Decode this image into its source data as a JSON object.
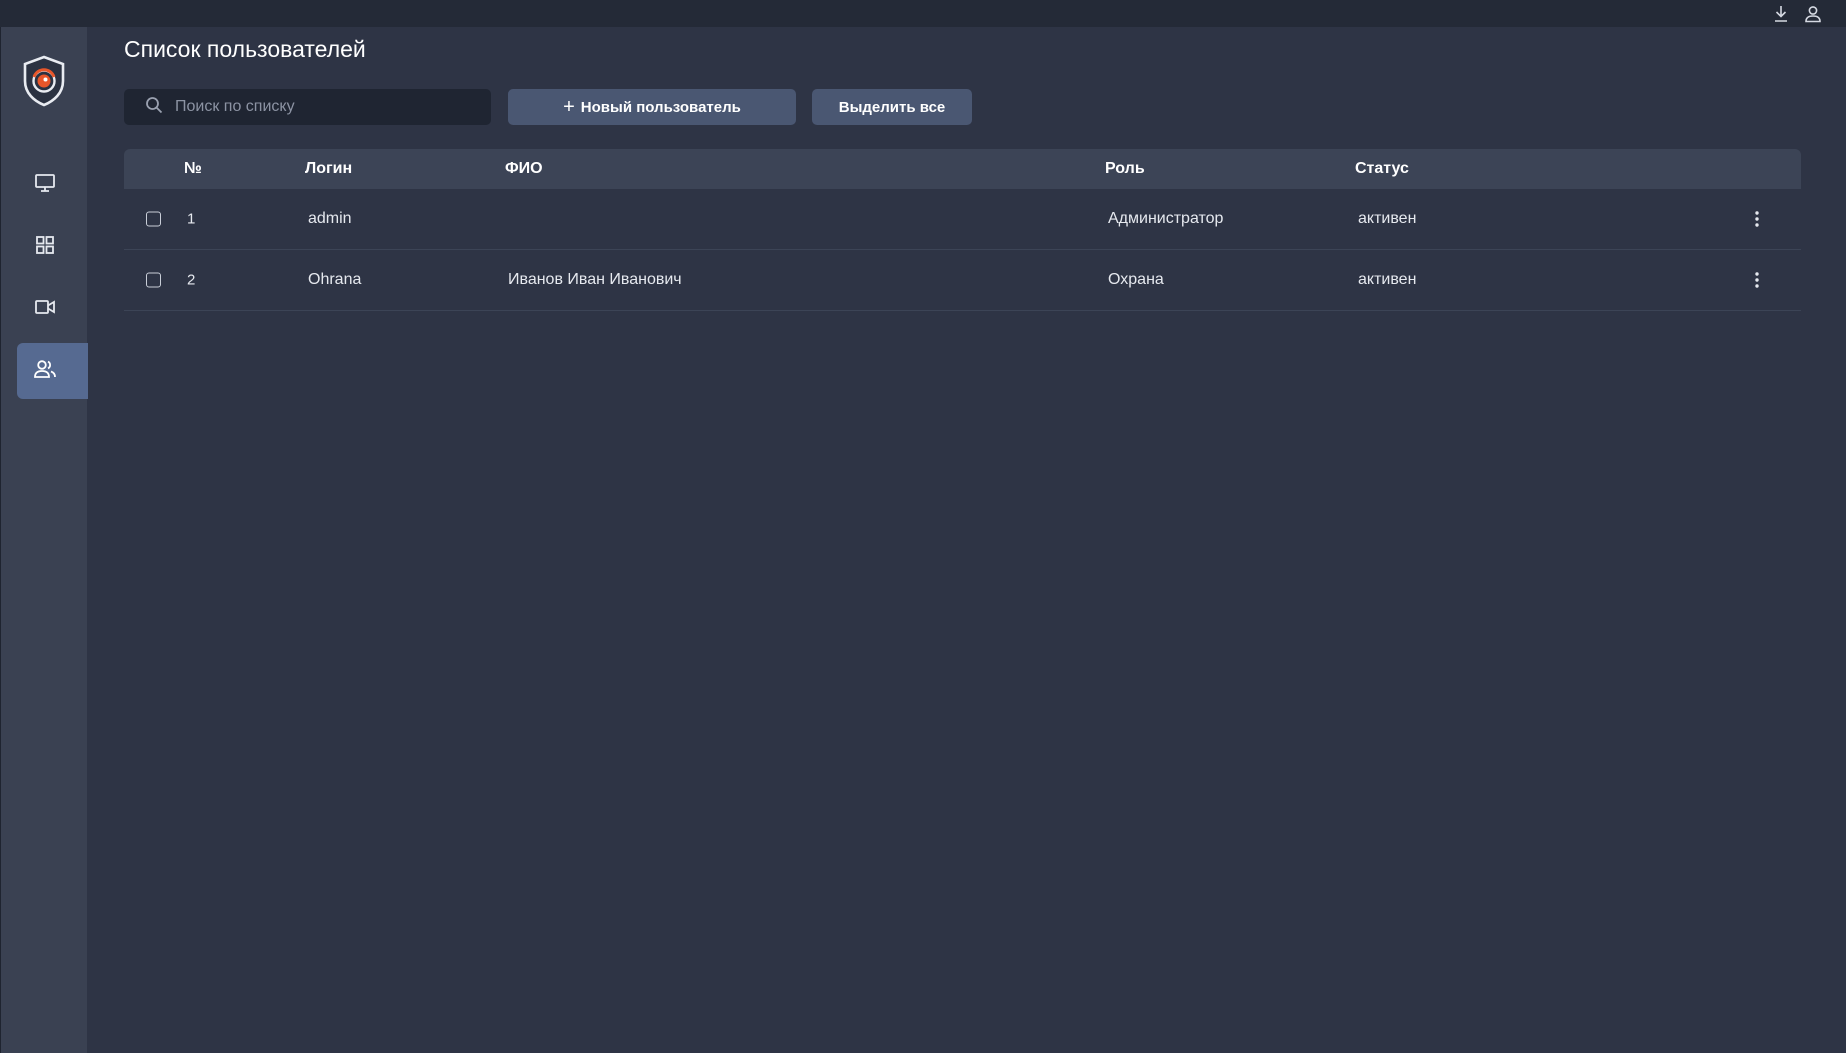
{
  "page": {
    "title": "Список пользователей"
  },
  "search": {
    "placeholder": "Поиск по списку",
    "value": ""
  },
  "toolbar": {
    "new_user_label": "Новый пользователь",
    "select_all_label": "Выделить все"
  },
  "topbar": {
    "icons": [
      "download-icon",
      "user-icon"
    ]
  },
  "sidebar": {
    "items": [
      {
        "icon": "monitor-icon",
        "active": false
      },
      {
        "icon": "grid-icon",
        "active": false
      },
      {
        "icon": "video-camera-icon",
        "active": false
      },
      {
        "icon": "users-icon",
        "active": true
      }
    ]
  },
  "table": {
    "columns": {
      "no": "№",
      "login": "Логин",
      "fio": "ФИО",
      "role": "Роль",
      "status": "Статус"
    },
    "rows": [
      {
        "no": "1",
        "login": "admin",
        "fio": "",
        "role": "Администратор",
        "status": "активен"
      },
      {
        "no": "2",
        "login": "Ohrana",
        "fio": "Иванов Иван Иванович",
        "role": "Охрана",
        "status": "активен"
      }
    ]
  },
  "colors": {
    "background": "#2e3445",
    "sidebar": "#3a4152",
    "topbar": "#242a37",
    "active_nav": "#566a91",
    "button": "#4a5772",
    "logo_accent": "#e8562a"
  }
}
